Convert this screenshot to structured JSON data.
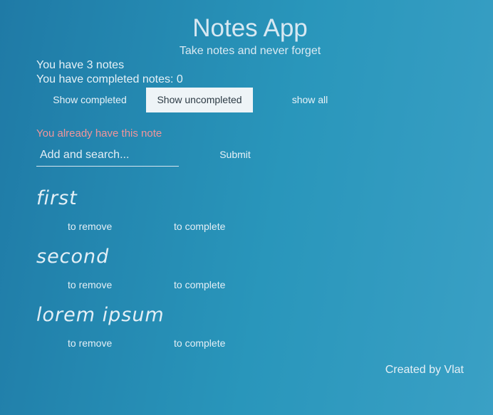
{
  "header": {
    "title": "Notes App",
    "subtitle": "Take notes and never forget"
  },
  "stats": {
    "total": "You have 3 notes",
    "completed": "You have completed notes: 0"
  },
  "filters": {
    "completed": "Show completed",
    "uncompleted": "Show uncompleted",
    "all": "show all",
    "active": "uncompleted"
  },
  "form": {
    "warning": "You already have this note",
    "placeholder": "Add and search...",
    "value": "",
    "submit": "Submit"
  },
  "notes": [
    {
      "title": "first",
      "remove": "to remove",
      "complete": "to complete"
    },
    {
      "title": "second",
      "remove": "to remove",
      "complete": "to complete"
    },
    {
      "title": "lorem ipsum",
      "remove": "to remove",
      "complete": "to complete"
    }
  ],
  "footer": {
    "credit": "Created by Vlat"
  },
  "colors": {
    "background_start": "#1f7aa6",
    "background_end": "#3aa0c5",
    "active_button_bg": "#eef4f7",
    "warning": "#f1959b"
  }
}
